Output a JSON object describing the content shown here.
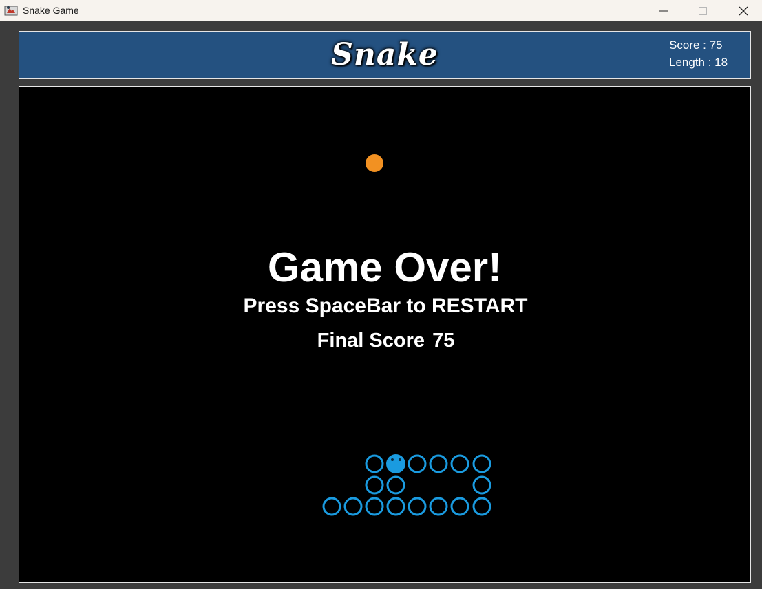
{
  "window": {
    "title": "Snake Game",
    "controls": [
      "minimize",
      "maximize",
      "close"
    ]
  },
  "header": {
    "logo_text": "Snake",
    "score_label": "Score : 75",
    "length_label": "Length : 18"
  },
  "board": {
    "game_over_text": "Game Over!",
    "restart_text": "Press SpaceBar to RESTART",
    "final_score_label": "Final Score",
    "final_score_value": "75"
  },
  "game_state": {
    "score": 75,
    "length": 18,
    "status": "game over"
  },
  "colors": {
    "header_bg": "#245180",
    "board_bg": "#000000",
    "snake": "#1a9be0",
    "food": "#f29122",
    "text": "#ffffff"
  },
  "icons": {
    "app": "java-app-icon",
    "minimize": "minimize-icon",
    "maximize": "maximize-icon",
    "close": "close-icon"
  }
}
